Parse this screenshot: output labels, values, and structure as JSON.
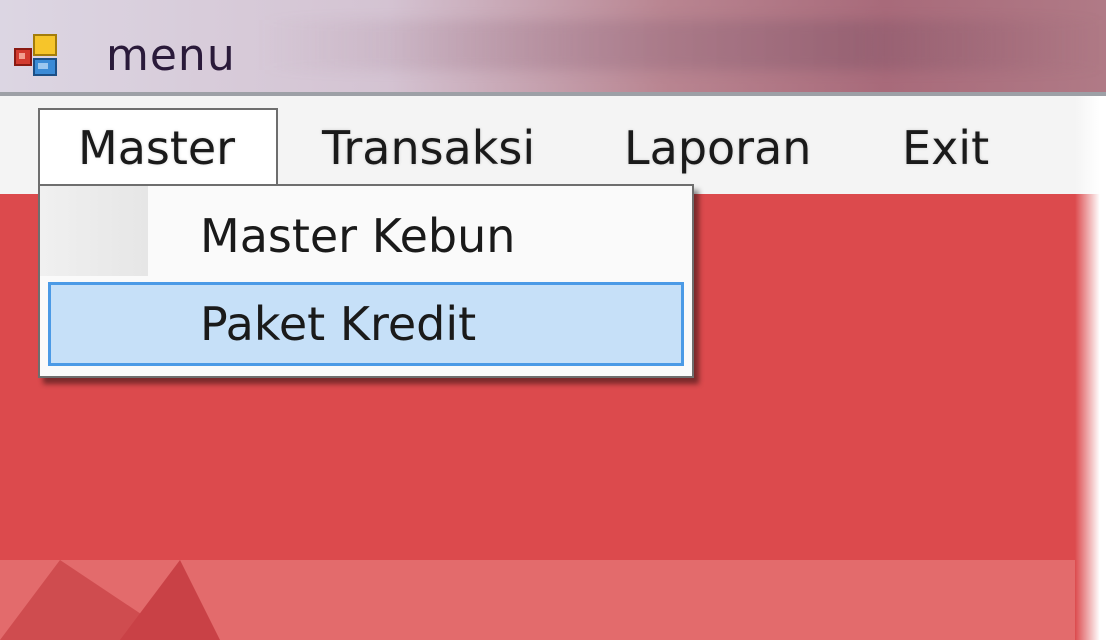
{
  "window": {
    "title": "menu",
    "icon": "app-window-icon"
  },
  "menubar": {
    "items": [
      {
        "label": "Master",
        "active": true
      },
      {
        "label": "Transaksi"
      },
      {
        "label": "Laporan"
      },
      {
        "label": "Exit"
      }
    ]
  },
  "dropdown": {
    "parent": "Master",
    "items": [
      {
        "label": "Master Kebun"
      },
      {
        "label": "Paket Kredit",
        "highlighted": true
      }
    ]
  },
  "colors": {
    "content_background": "#dc4a4d",
    "highlight_fill": "#c6e0f8",
    "highlight_border": "#4b9ae6"
  }
}
